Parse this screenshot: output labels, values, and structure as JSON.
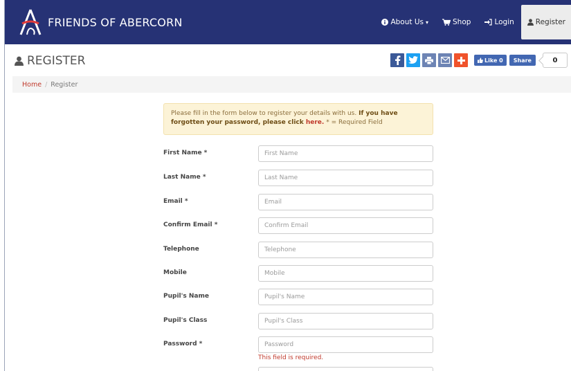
{
  "brand": {
    "name": "FRIENDS OF ABERCORN"
  },
  "nav": [
    {
      "label": "About Us",
      "icon": "info-icon",
      "caret": "▾"
    },
    {
      "label": "Shop",
      "icon": "cart-icon"
    },
    {
      "label": "Login",
      "icon": "sign-in-icon"
    },
    {
      "label": "Register",
      "icon": "user-icon"
    }
  ],
  "page": {
    "title": "REGISTER"
  },
  "share": {
    "facebook_color": "#3b5998",
    "twitter_color": "#1da1f2",
    "print_color": "#6d84b4",
    "email_color": "#6d84b4",
    "more_color": "#f0532b",
    "like_label": "Like 0",
    "share_label": "Share",
    "count": "0"
  },
  "breadcrumb": {
    "home": "Home",
    "separator": "/",
    "current": "Register"
  },
  "alert": {
    "intro": "Please fill in the form below to register your details with us. ",
    "bold": "If you have forgotten your password, please click ",
    "link": "here.",
    "note": " * = Required Field"
  },
  "form": {
    "fields": [
      {
        "label": "First Name *",
        "placeholder": "First Name",
        "value": ""
      },
      {
        "label": "Last Name *",
        "placeholder": "Last Name",
        "value": ""
      },
      {
        "label": "Email *",
        "placeholder": "Email",
        "value": ""
      },
      {
        "label": "Confirm Email *",
        "placeholder": "Confirm Email",
        "value": ""
      },
      {
        "label": "Telephone",
        "placeholder": "Telephone",
        "value": ""
      },
      {
        "label": "Mobile",
        "placeholder": "Mobile",
        "value": ""
      },
      {
        "label": "Pupil's Name",
        "placeholder": "Pupil's Name",
        "value": ""
      },
      {
        "label": "Pupil's Class",
        "placeholder": "Pupil's Class",
        "value": ""
      },
      {
        "label": "Password *",
        "placeholder": "Password",
        "value": ""
      }
    ],
    "password_error": "This field is required."
  },
  "colors": {
    "navbar": "#263275",
    "accent": "#c0392b",
    "alert_bg": "#fcf3d7"
  }
}
